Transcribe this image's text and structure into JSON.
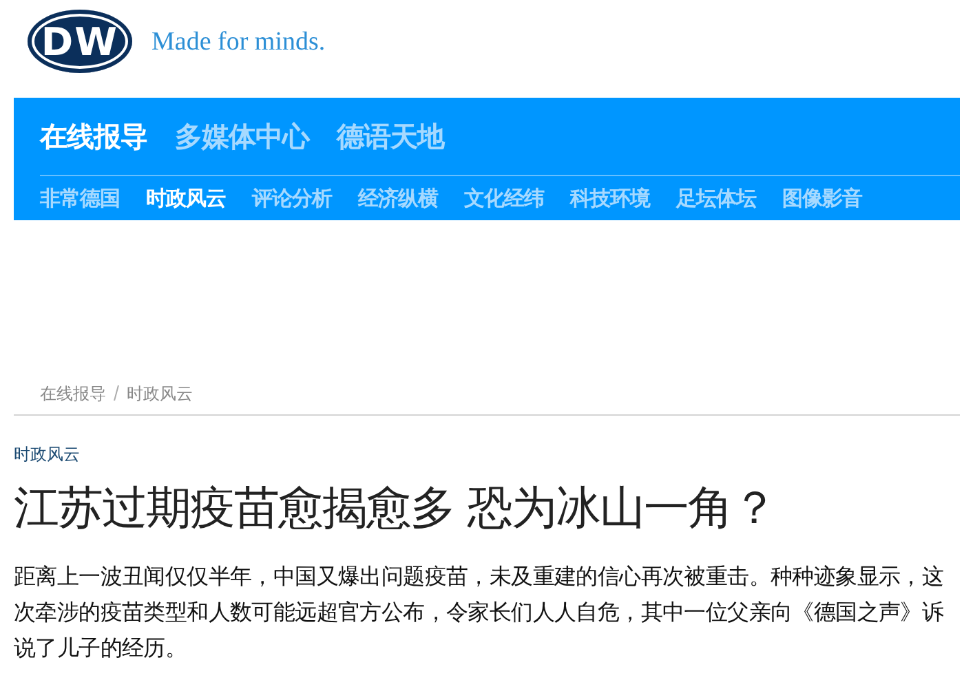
{
  "header": {
    "logo_text": "DW",
    "tagline": "Made for minds."
  },
  "nav": {
    "primary": [
      {
        "label": "在线报导",
        "selected": true
      },
      {
        "label": "多媒体中心",
        "selected": false
      },
      {
        "label": "德语天地",
        "selected": false
      }
    ],
    "secondary": [
      {
        "label": "非常德国",
        "selected": false
      },
      {
        "label": "时政风云",
        "selected": true
      },
      {
        "label": "评论分析",
        "selected": false
      },
      {
        "label": "经济纵横",
        "selected": false
      },
      {
        "label": "文化经纬",
        "selected": false
      },
      {
        "label": "科技环境",
        "selected": false
      },
      {
        "label": "足坛体坛",
        "selected": false
      },
      {
        "label": "图像影音",
        "selected": false
      }
    ]
  },
  "breadcrumb": [
    "在线报导",
    "时政风云"
  ],
  "article": {
    "category": "时政风云",
    "headline": "江苏过期疫苗愈揭愈多 恐为冰山一角？",
    "lead": "距离上一波丑闻仅仅半年，中国又爆出问题疫苗，未及重建的信心再次被重击。种种迹象显示，这次牵涉的疫苗类型和人数可能远超官方公布，令家长们人人自危，其中一位父亲向《德国之声》诉说了儿子的经历。"
  }
}
